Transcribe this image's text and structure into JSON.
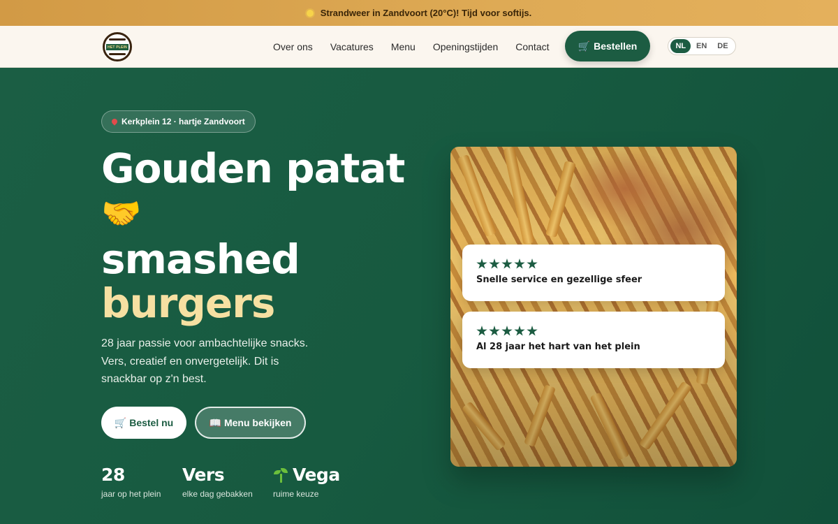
{
  "announcement": {
    "icon": "sun-icon",
    "text": "Strandweer in Zandvoort (20°C)! Tijd voor softijs."
  },
  "logo": {
    "text": "HET PLEIN"
  },
  "nav": {
    "links": [
      "Over ons",
      "Vacatures",
      "Menu",
      "Openingstijden",
      "Contact"
    ],
    "order_label": "Bestellen",
    "languages": [
      "NL",
      "EN",
      "DE"
    ],
    "active_language": "NL"
  },
  "hero": {
    "location": "Kerkplein 12 · hartje Zandvoort",
    "headline_1": "Gouden patat",
    "headline_emoji": "🤝",
    "headline_2": "smashed",
    "headline_3": "burgers",
    "lead": "28 jaar passie voor ambachtelijke snacks. Vers, creatief en onvergetelijk. Dit is snackbar op z'n best.",
    "cta_primary": "Bestel nu",
    "cta_secondary": "Menu bekijken",
    "stats": [
      {
        "value": "28",
        "caption": "jaar op het plein"
      },
      {
        "value": "Vers",
        "caption": "elke dag gebakken"
      },
      {
        "value": "Vega",
        "caption": "ruime keuze",
        "icon": "sprout-icon"
      }
    ]
  },
  "reviews": [
    {
      "rating": 5,
      "text": "Snelle service en gezellige sfeer"
    },
    {
      "rating": 5,
      "text": "Al 28 jaar het hart van het plein"
    }
  ],
  "colors": {
    "brand_green": "#1c5c42",
    "announce_bar": "#deaa55",
    "accent_yellow": "#f6e0a2"
  }
}
